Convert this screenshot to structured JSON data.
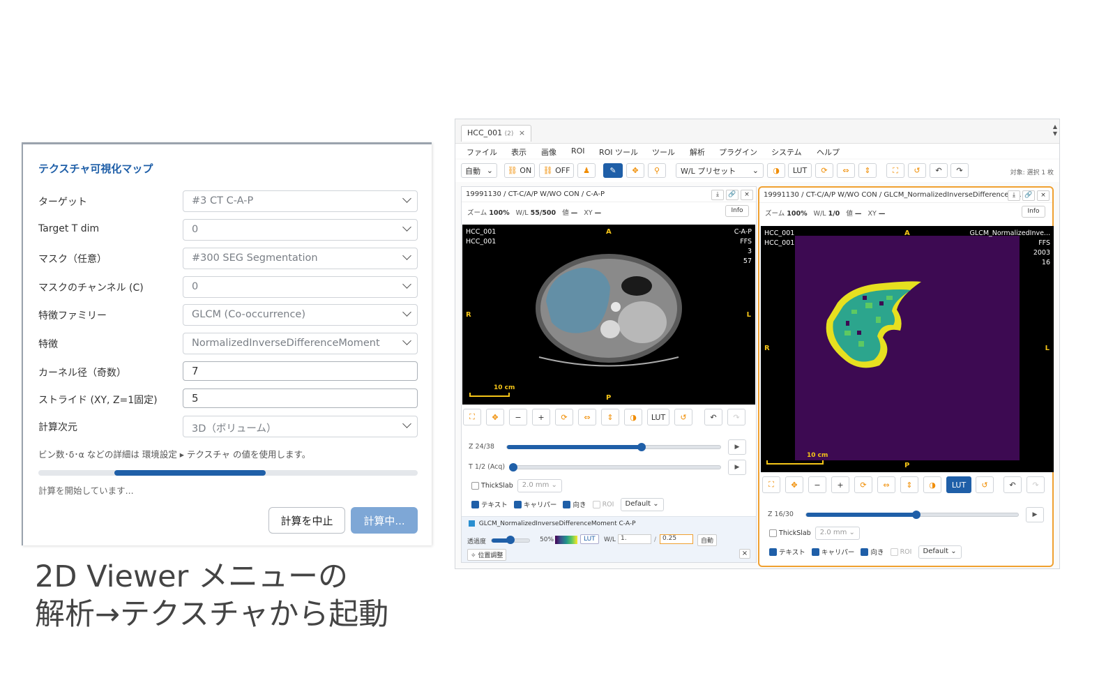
{
  "dialog": {
    "title": "テクスチャ可視化マップ",
    "fields": [
      {
        "label": "ターゲット",
        "value": "#3 CT C-A-P",
        "type": "select"
      },
      {
        "label": "Target T dim",
        "value": "0",
        "type": "select"
      },
      {
        "label": "マスク（任意）",
        "value": "#300 SEG Segmentation",
        "type": "select"
      },
      {
        "label": "マスクのチャンネル (C)",
        "value": "0",
        "type": "select"
      },
      {
        "label": "特徴ファミリー",
        "value": "GLCM (Co-occurrence)",
        "type": "select"
      },
      {
        "label": "特徴",
        "value": "NormalizedInverseDifferenceMoment",
        "type": "select"
      },
      {
        "label": "カーネル径（奇数）",
        "value": "7",
        "type": "input"
      },
      {
        "label": "ストライド (XY, Z=1固定)",
        "value": "5",
        "type": "input"
      },
      {
        "label": "計算次元",
        "value": "3D（ボリューム）",
        "type": "select"
      }
    ],
    "hint": "ビン数･δ･α などの詳細は 環境設定 ▸ テクスチャ の値を使用します。",
    "progress": {
      "start": 0.2,
      "end": 0.6
    },
    "status": "計算を開始しています...",
    "stop_label": "計算を中止",
    "run_label": "計算中..."
  },
  "caption": {
    "line1": "2D Viewer メニューの",
    "line2": "解析→テクスチャから起動"
  },
  "app": {
    "tab": {
      "title": "HCC_001",
      "count": "(2)",
      "close": "×"
    },
    "menu": [
      "ファイル",
      "表示",
      "画像",
      "ROI",
      "ROI ツール",
      "ツール",
      "解析",
      "プラグイン",
      "システム",
      "ヘルプ"
    ],
    "toolbar": {
      "mode": "自動",
      "link_on": "ON",
      "link_off": "OFF",
      "wl_preset": "W/L プリセット",
      "lut": "LUT",
      "target": "対象: 選択 1 枚"
    },
    "left_panel": {
      "title": "19991130 / CT-C/A/P W/WO CON / C-A-P",
      "zoom_label": "ズーム",
      "zoom": "100%",
      "wl_label": "W/L",
      "wl": "55/500",
      "val_label": "値",
      "val": "—",
      "xy_label": "XY",
      "xy": "—",
      "info": "Info",
      "overlay": {
        "tl1": "HCC_001",
        "tl2": "HCC_001",
        "tr1": "C-A-P",
        "tr2": "FFS",
        "tr3": "3",
        "tr4": "57",
        "top": "A",
        "bottom": "P",
        "left": "R",
        "right": "L",
        "scale": "10 cm"
      },
      "lut": "LUT",
      "z_label": "Z 24/38",
      "z_pos": 0.63,
      "t_label": "T 1/2 (Acq)",
      "t_pos": 0.0,
      "thickslab": "ThickSlab",
      "thick_val": "2.0 mm",
      "text": "テキスト",
      "caliper": "キャリパー",
      "orient": "向き",
      "roi": "ROI",
      "preset": "Default",
      "overlay_layer": "GLCM_NormalizedInverseDifferenceMoment C-A-P",
      "opacity_label": "透過度",
      "opacity": "50%",
      "opacity_pos": 0.5,
      "wl2_label": "W/L",
      "w_val": "1.",
      "l_val": "0.25",
      "auto": "自動",
      "adjust": "位置調整",
      "close": "×"
    },
    "right_panel": {
      "title": "19991130 / CT-C/A/P W/WO CON / GLCM_NormalizedInverseDifferenceM...",
      "zoom_label": "ズーム",
      "zoom": "100%",
      "wl_label": "W/L",
      "wl": "1/0",
      "val_label": "値",
      "val": "—",
      "xy_label": "XY",
      "xy": "—",
      "info": "Info",
      "overlay": {
        "tl1": "HCC_001",
        "tl2": "HCC_001",
        "tr1": "GLCM_NormalizedInve...",
        "tr2": "FFS",
        "tr3": "2003",
        "tr4": "16",
        "top": "A",
        "bottom": "P",
        "left": "R",
        "right": "L",
        "scale": "10 cm"
      },
      "lut": "LUT",
      "z_label": "Z 16/30",
      "z_pos": 0.52,
      "thickslab": "ThickSlab",
      "thick_val": "2.0 mm",
      "text": "テキスト",
      "caliper": "キャリパー",
      "orient": "向き",
      "roi": "ROI",
      "preset": "Default"
    },
    "colors": {
      "accent": "#1f5fa8",
      "selected_border": "#f0a030",
      "overlay_text": "#f5c518",
      "texture_bg": "#3d0a52",
      "texture_fg": "#e6e020"
    }
  }
}
